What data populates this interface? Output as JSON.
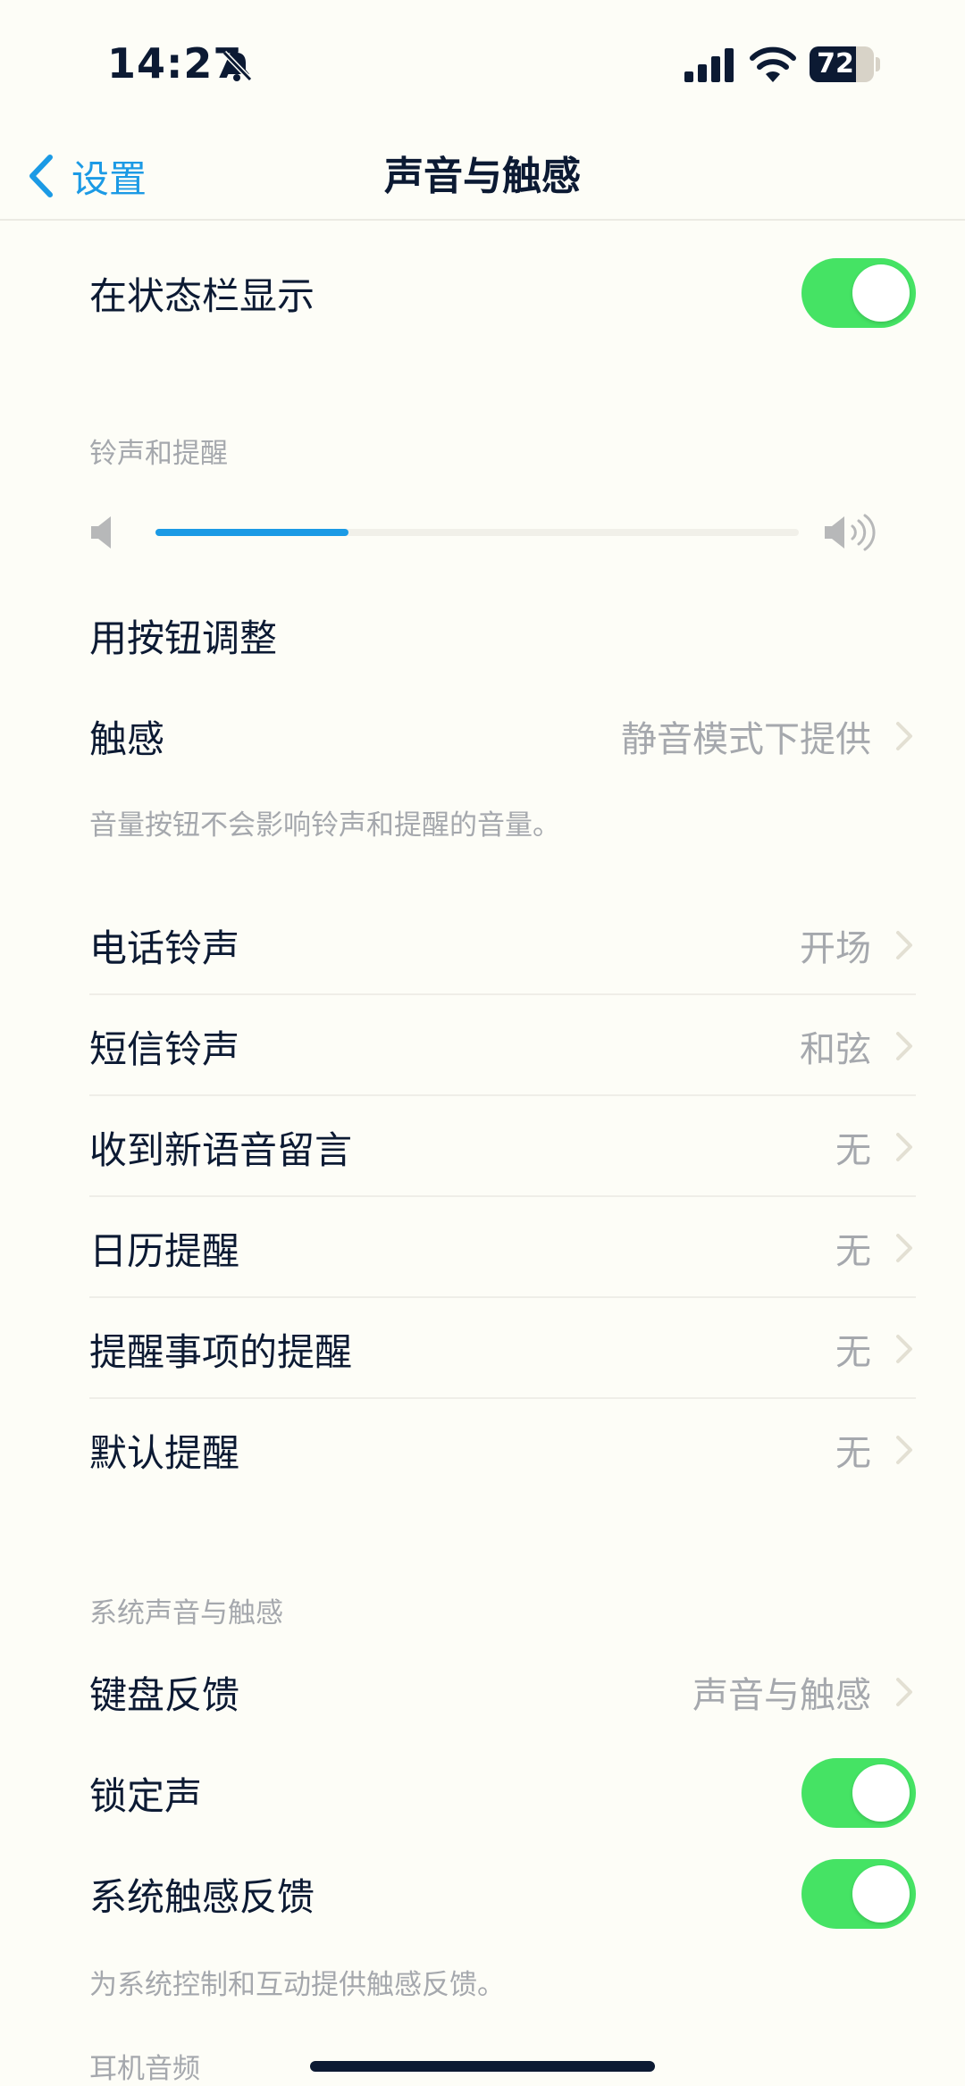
{
  "status_bar": {
    "time": "14:27",
    "battery": "72",
    "battery_level": 0.72
  },
  "nav": {
    "back_label": "设置",
    "title": "声音与触感"
  },
  "top_toggle": {
    "label": "在状态栏显示",
    "on": true
  },
  "ringer_section": {
    "header": "铃声和提醒",
    "volume_level": 0.3,
    "adjust_with_buttons": "用按钮调整",
    "haptics_label": "触感",
    "haptics_value": "静音模式下提供",
    "footer": "音量按钮不会影响铃声和提醒的音量。"
  },
  "sound_list": [
    {
      "label": "电话铃声",
      "value": "开场"
    },
    {
      "label": "短信铃声",
      "value": "和弦"
    },
    {
      "label": "收到新语音留言",
      "value": "无"
    },
    {
      "label": "日历提醒",
      "value": "无"
    },
    {
      "label": "提醒事项的提醒",
      "value": "无"
    },
    {
      "label": "默认提醒",
      "value": "无"
    }
  ],
  "system_section": {
    "header": "系统声音与触感",
    "keyboard_label": "键盘反馈",
    "keyboard_value": "声音与触感",
    "lock_sound_label": "锁定声",
    "lock_sound_on": true,
    "system_haptics_label": "系统触感反馈",
    "system_haptics_on": true,
    "footer": "为系统控制和互动提供触感反馈。"
  },
  "headphone_section": {
    "header": "耳机音频"
  },
  "colors": {
    "accent": "#1b9ae5",
    "toggle_on": "#45e364",
    "background": "#fdfdf7",
    "text": "#0c1a33",
    "secondary_text": "#a5a8ad"
  },
  "icons": {
    "bell": "bell-slash-icon",
    "signal": "cellular-signal-icon",
    "wifi": "wifi-icon",
    "battery": "battery-icon",
    "back": "chevron-left-icon",
    "disclosure": "chevron-right-icon",
    "volume_low": "speaker-low-icon",
    "volume_high": "speaker-high-icon"
  }
}
